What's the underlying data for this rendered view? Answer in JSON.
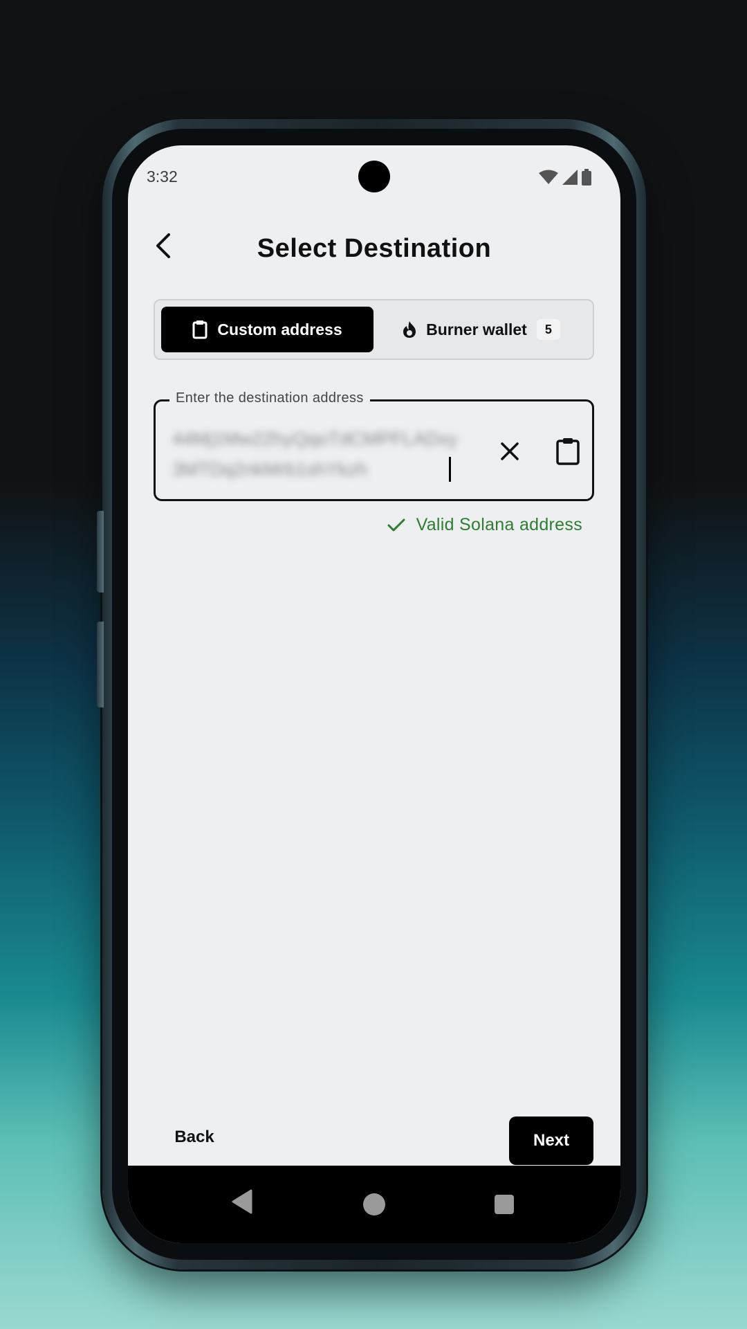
{
  "status_bar": {
    "time": "3:32",
    "icons": [
      "wifi-icon",
      "signal-icon",
      "battery-icon"
    ]
  },
  "header": {
    "title": "Select Destination",
    "back_icon": "chevron-left-icon"
  },
  "tabs": [
    {
      "label": "Custom address",
      "icon": "clipboard-icon",
      "selected": true
    },
    {
      "label": "Burner wallet",
      "icon": "flame-icon",
      "badge": "5",
      "selected": false
    }
  ],
  "address_field": {
    "label": "Enter the destination address",
    "value": "44Mj1Mw22hyQqoTdCMPFLADxy3MTDq2nkMrb1shYkzh",
    "clear_icon": "close-icon",
    "paste_icon": "clipboard-icon"
  },
  "validation": {
    "icon": "check-icon",
    "message": "Valid Solana address",
    "color": "#2e7d32"
  },
  "footer": {
    "back_label": "Back",
    "next_label": "Next"
  },
  "nav_bar": {
    "icons": [
      "nav-back-icon",
      "nav-home-icon",
      "nav-recents-icon"
    ]
  },
  "colors": {
    "primary": "#000000",
    "screen_bg": "#eeeff1",
    "success": "#2e7d32"
  }
}
